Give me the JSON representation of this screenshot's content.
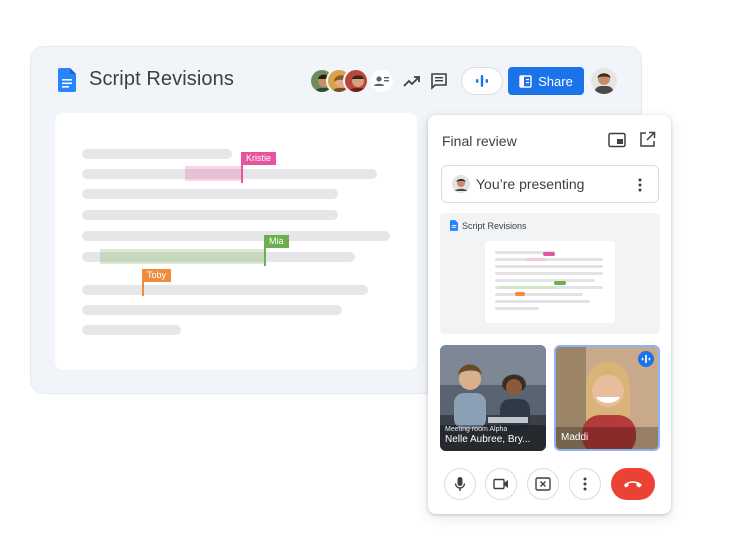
{
  "doc": {
    "title": "Script Revisions",
    "share_label": "Share",
    "icons": [
      "docs-icon",
      "trending-icon",
      "comment-icon",
      "meet-audio-icon",
      "share-icon",
      "present-icon"
    ],
    "collaborators": [
      {
        "name": "Kristie",
        "color": "#e8539f"
      },
      {
        "name": "Mia",
        "color": "#6ab04c"
      },
      {
        "name": "Toby",
        "color": "#ef8d3c"
      }
    ]
  },
  "meet_panel": {
    "title": "Final review",
    "presenting_label": "You’re presenting",
    "preview_doc_title": "Script Revisions",
    "tiles": [
      {
        "name": "Meeting room Alpha",
        "label": "Nelle Aubree, Bry..."
      },
      {
        "name": "",
        "label": "Maddi"
      }
    ],
    "controls": [
      "mic-icon",
      "camera-icon",
      "stop-present-icon",
      "more-icon",
      "end-call-icon"
    ]
  },
  "colors": {
    "accent": "#1a73e8",
    "end_call": "#ea4335",
    "kristie": "#e8539f",
    "mia": "#6ab04c",
    "toby": "#ef8d3c"
  }
}
